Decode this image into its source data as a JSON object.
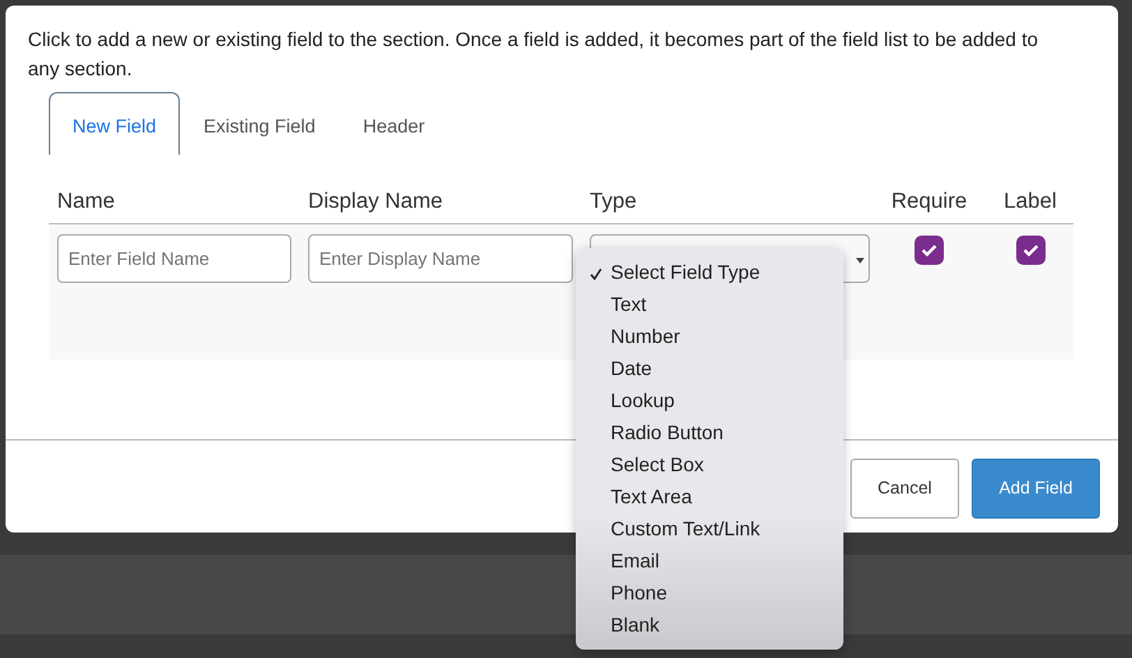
{
  "description": "Click to add a new or existing field to the section. Once a field is added, it becomes part of the field list to be added to any section.",
  "tabs": [
    {
      "label": "New Field",
      "selected": true
    },
    {
      "label": "Existing Field",
      "selected": false
    },
    {
      "label": "Header",
      "selected": false
    }
  ],
  "table": {
    "columns": [
      "Name",
      "Display Name",
      "Type",
      "Require",
      "Label"
    ],
    "row": {
      "name": {
        "placeholder": "Enter Field Name"
      },
      "display_name": {
        "placeholder": "Enter Display Name"
      },
      "require": {
        "checked": true
      },
      "label": {
        "checked": true
      }
    }
  },
  "type_dropdown": {
    "options": [
      {
        "label": "Select Field Type",
        "selected": true
      },
      {
        "label": "Text",
        "selected": false
      },
      {
        "label": "Number",
        "selected": false
      },
      {
        "label": "Date",
        "selected": false
      },
      {
        "label": "Lookup",
        "selected": false
      },
      {
        "label": "Radio Button",
        "selected": false
      },
      {
        "label": "Select Box",
        "selected": false
      },
      {
        "label": "Text Area",
        "selected": false
      },
      {
        "label": "Custom Text/Link",
        "selected": false
      },
      {
        "label": "Email",
        "selected": false
      },
      {
        "label": "Phone",
        "selected": false
      },
      {
        "label": "Blank",
        "selected": false
      }
    ]
  },
  "buttons": [
    {
      "label": "Cancel",
      "kind": "secondary"
    },
    {
      "label": "Add Field",
      "kind": "primary"
    }
  ]
}
